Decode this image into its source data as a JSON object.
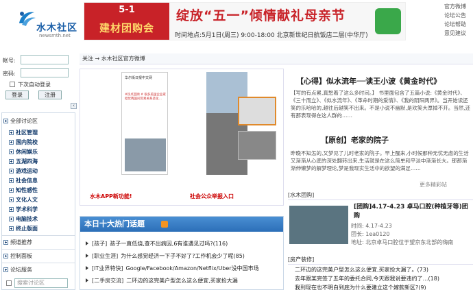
{
  "logo": {
    "name": "水木社区",
    "sub": "newsmth.net"
  },
  "banner": {
    "left_line1": "5-1",
    "left_line2": "建材团购会",
    "title": "绽放“五一”倾情献礼母亲节",
    "sub": "时间地点:5月1日(周三) 9:00-18:00 北京新世纪日航饭店二层(中华厅)"
  },
  "toplinks": [
    "官方微博",
    "论坛公告",
    "论坛帮助",
    "意见建议"
  ],
  "login": {
    "user_label": "帐号:",
    "pass_label": "密码:",
    "auto_label": "下次自动登录",
    "login_btn": "登录",
    "register_btn": "注册"
  },
  "sidebar": {
    "all": "全部讨论区",
    "items": [
      "社区管理",
      "国内院校",
      "休闲娱乐",
      "五湖四海",
      "游戏运动",
      "社会信息",
      "知性感性",
      "文化人文",
      "学术科学",
      "电脑技术",
      "终止版面"
    ],
    "recommend": "频道推荐",
    "control": "控制面板",
    "service": "论坛服务",
    "search_placeholder": "搜索讨论区"
  },
  "crumb": "关注 → 水木社区官方微博",
  "weibo": {
    "img_title": "华尔街日报中文网",
    "img_text": "#热点回顾 # 很多美国企业家担忧两国间贸易关系恶化…",
    "link1": "水木APP新功能!",
    "link2": "社会公众举报入口"
  },
  "top10": {
    "title": "本日十大热门话题",
    "items": [
      {
        "tag": "[孩子]",
        "text": "孩子一直低烧,查不出病因,6有谁遇见过吗?",
        "count": "(116)"
      },
      {
        "tag": "[职业生涯]",
        "text": "为什么感觉经济一下子不好了?工作机会少了呢",
        "count": "(85)"
      },
      {
        "tag": "[IT业界特快]",
        "text": "Google/Facebook/Amazon/Netflix/Uber没中国市场",
        "count": ""
      },
      {
        "tag": "[二手房交流]",
        "text": "二环边的这完美户型怎么这么便宜,买家捡大漏",
        "count": ""
      }
    ]
  },
  "articles": [
    {
      "title": "【心得】似水流年──读王小波《黄金时代》",
      "body": "【写的有点累,真愁着了这么多时间。】 书里面包含了五篇小说:《黄金时代》、《三十而立》、《似水流年》、《革命时期的爱情》、《我的阴阳两界》。当开始读还笑的乐哈哈的,越往后越笑不出来。不是小说不幽默,是欢笑大厚掉不开。当然,还有那表现得在这人群的……"
    },
    {
      "title": "【原创】老家的院子",
      "body": "昨晚不知怎的,又梦见了儿时老家的院子。早上醒来,小时候那种无忧无虑的生活又渐渐从心底的深处翻转出来,生活就是在这么简单和平淡中渐渐长大。那那渐渐伸懒梦的解梦理论,梦是我现实生活中的欲望的满足……"
    }
  ],
  "more": "更多精彩帖",
  "tuangou": {
    "section": "[水木团购]",
    "title": "[团购]4.17-4.23 卓马口腔(种植牙等)团购",
    "date": "时间: 4.17-4.23",
    "count": "团长: 1ea0120",
    "addr": "地址: 北京卓马口腔位于望京东北部的嗨南"
  },
  "house": {
    "section": "[房产装修]",
    "items": [
      {
        "text": "二环边的这完美户型怎么这么便宜,买家捡大漏了。",
        "count": "(73)"
      },
      {
        "text": "去年跟某完签了五年的委托合同,今天跟我说要违约了…",
        "count": "(18)"
      },
      {
        "text": "我到现在也不明白到底为什么要建立这个嫁款新区?",
        "count": "(9)"
      }
    ]
  },
  "colors": {
    "brand": "#1b5fa8",
    "banner_red": "#c82228",
    "header_blue": "#2c6fb8"
  }
}
